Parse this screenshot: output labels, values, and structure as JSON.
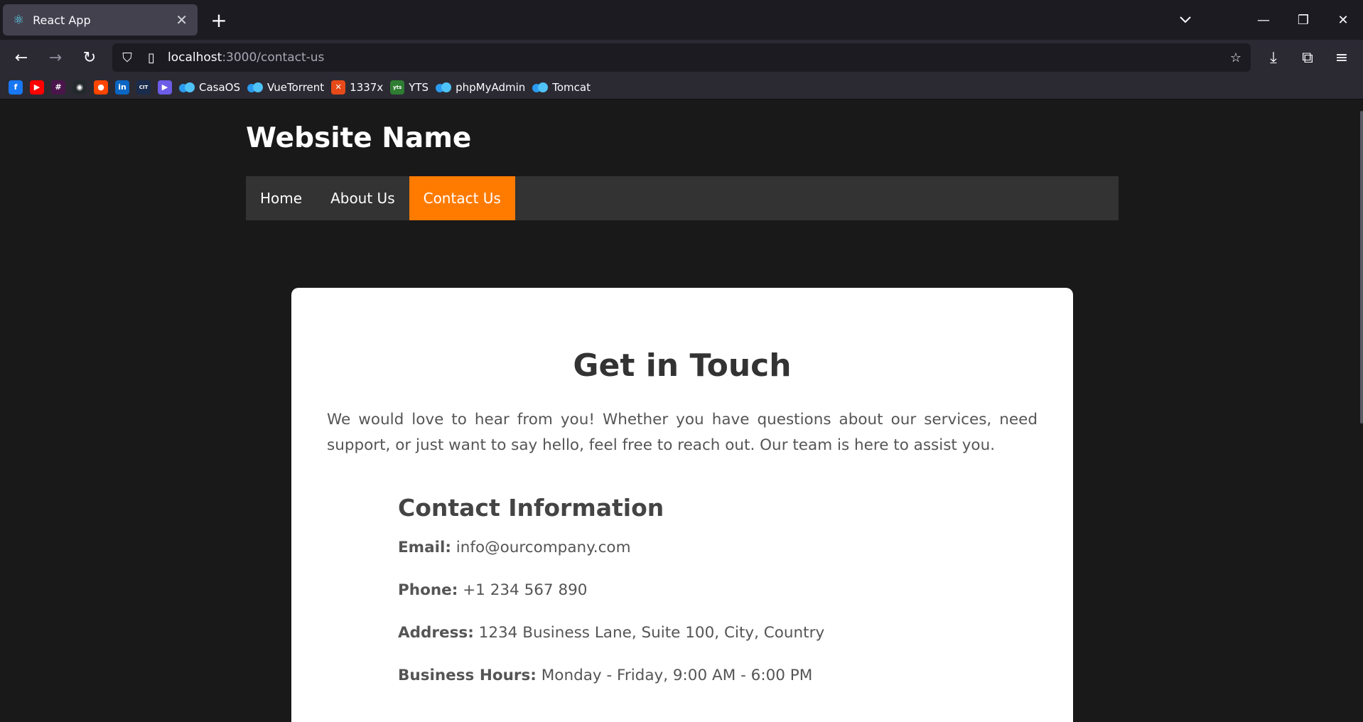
{
  "browser": {
    "tab_title": "React App",
    "url_host": "localhost",
    "url_path": ":3000/contact-us",
    "bookmarks": [
      {
        "label": "",
        "icon": "facebook-icon",
        "color": "#1877f2",
        "glyph": "f"
      },
      {
        "label": "",
        "icon": "youtube-icon",
        "color": "#ff0000",
        "glyph": "▶"
      },
      {
        "label": "",
        "icon": "slack-icon",
        "color": "#4a154b",
        "glyph": "#"
      },
      {
        "label": "",
        "icon": "github-icon",
        "color": "#24292e",
        "glyph": "◉"
      },
      {
        "label": "",
        "icon": "reddit-icon",
        "color": "#ff4500",
        "glyph": "●"
      },
      {
        "label": "",
        "icon": "linkedin-icon",
        "color": "#0a66c2",
        "glyph": "in"
      },
      {
        "label": "",
        "icon": "cit-icon",
        "color": "#1a2b4c",
        "glyph": "CIT"
      },
      {
        "label": "",
        "icon": "play-icon",
        "color": "#6c5ce7",
        "glyph": "▶"
      },
      {
        "label": "CasaOS",
        "icon": "cloud-icon"
      },
      {
        "label": "VueTorrent",
        "icon": "cloud-icon"
      },
      {
        "label": "1337x",
        "icon": "x-icon",
        "color": "#e64a19",
        "glyph": "✕"
      },
      {
        "label": "YTS",
        "icon": "yts-icon",
        "color": "#2e7d32",
        "glyph": "yts"
      },
      {
        "label": "phpMyAdmin",
        "icon": "cloud-icon"
      },
      {
        "label": "Tomcat",
        "icon": "cloud-icon"
      }
    ]
  },
  "site": {
    "title": "Website Name",
    "nav": [
      {
        "label": "Home",
        "active": false
      },
      {
        "label": "About Us",
        "active": false
      },
      {
        "label": "Contact Us",
        "active": true
      }
    ]
  },
  "contact": {
    "heading": "Get in Touch",
    "intro": "We would love to hear from you! Whether you have questions about our services, need support, or just want to say hello, feel free to reach out. Our team is here to assist you.",
    "info_heading": "Contact Information",
    "items": [
      {
        "label": "Email:",
        "value": "info@ourcompany.com"
      },
      {
        "label": "Phone:",
        "value": "+1 234 567 890"
      },
      {
        "label": "Address:",
        "value": "1234 Business Lane, Suite 100, City, Country"
      },
      {
        "label": "Business Hours:",
        "value": "Monday - Friday, 9:00 AM - 6:00 PM"
      }
    ]
  },
  "colors": {
    "accent": "#ff7b00",
    "nav_bg": "#333333",
    "page_bg": "#1a1919"
  }
}
